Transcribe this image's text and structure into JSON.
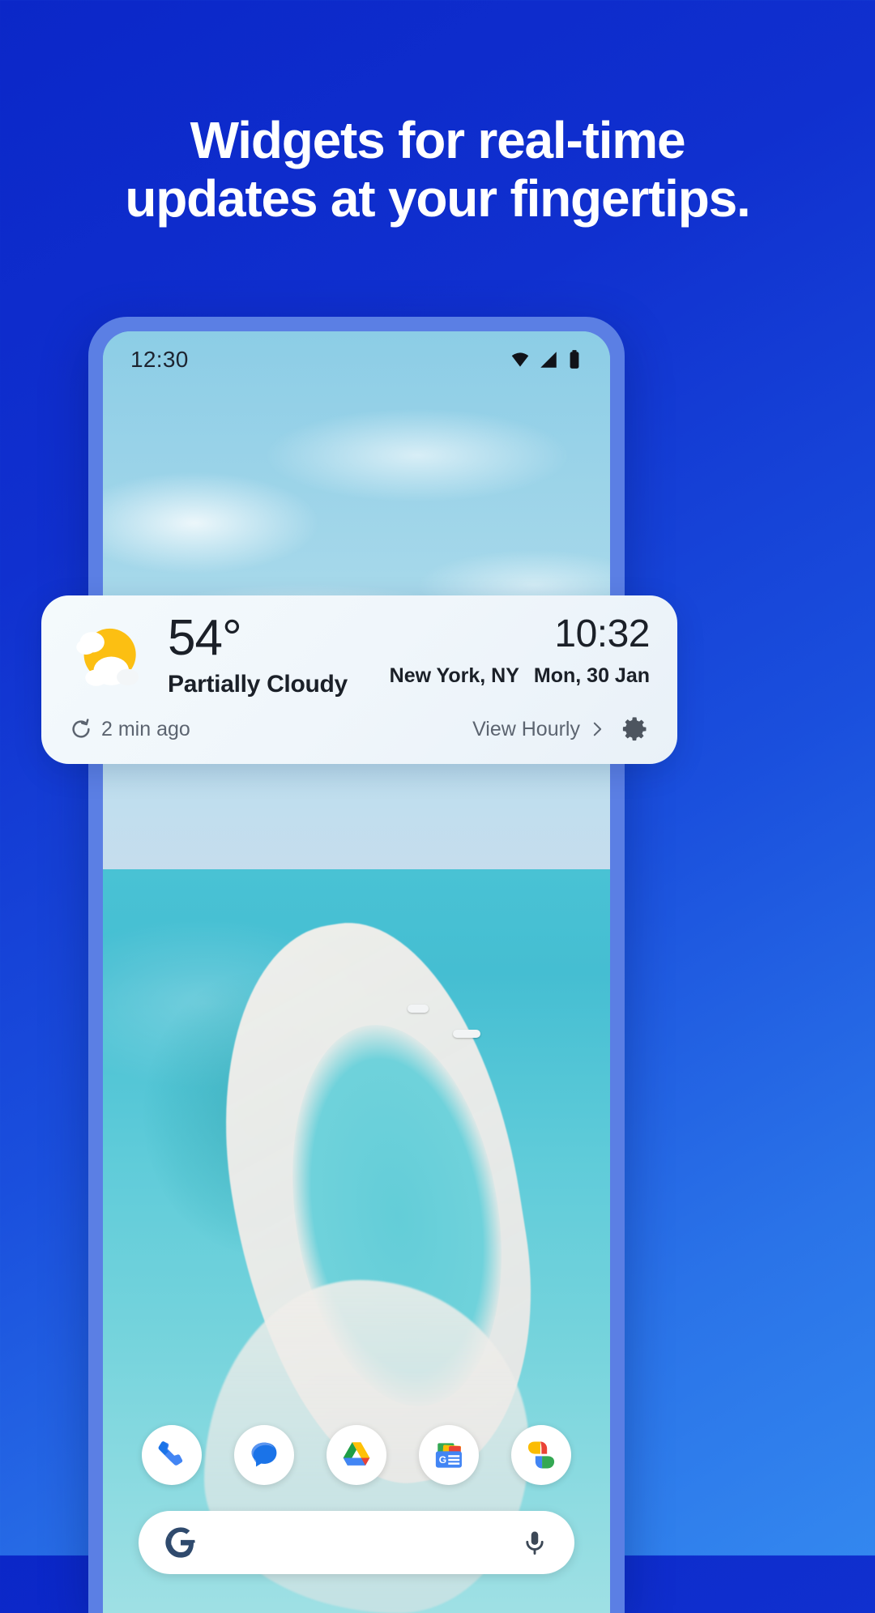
{
  "promo": {
    "headline_line1": "Widgets for real-time",
    "headline_line2": "updates at your fingertips.",
    "background_start": "#0b27c8",
    "background_end": "#3387ef"
  },
  "phone": {
    "status_bar": {
      "clock": "12:30",
      "icons": [
        "wifi-icon",
        "cellular-signal-icon",
        "battery-icon"
      ]
    },
    "weather_widget": {
      "condition_icon": "sun-behind-cloud-icon",
      "temperature": "54°",
      "condition": "Partially Cloudy",
      "time": "10:32",
      "location": "New York, NY",
      "date": "Mon, 30 Jan",
      "refresh_icon": "refresh-icon",
      "refresh_label": "2 min ago",
      "hourly_label": "View Hourly",
      "chevron_icon": "chevron-right-icon",
      "settings_icon": "gear-icon",
      "accent_sun": "#fcbf12",
      "card_background": "#f2f7fb"
    },
    "dock": [
      {
        "name": "Phone",
        "icon": "phone-icon"
      },
      {
        "name": "Messages",
        "icon": "messages-icon"
      },
      {
        "name": "Drive",
        "icon": "drive-icon"
      },
      {
        "name": "News",
        "icon": "news-icon"
      },
      {
        "name": "Photos",
        "icon": "photos-icon"
      }
    ],
    "search": {
      "logo_icon": "google-g-icon",
      "placeholder": "",
      "value": "",
      "mic_icon": "microphone-icon"
    }
  }
}
